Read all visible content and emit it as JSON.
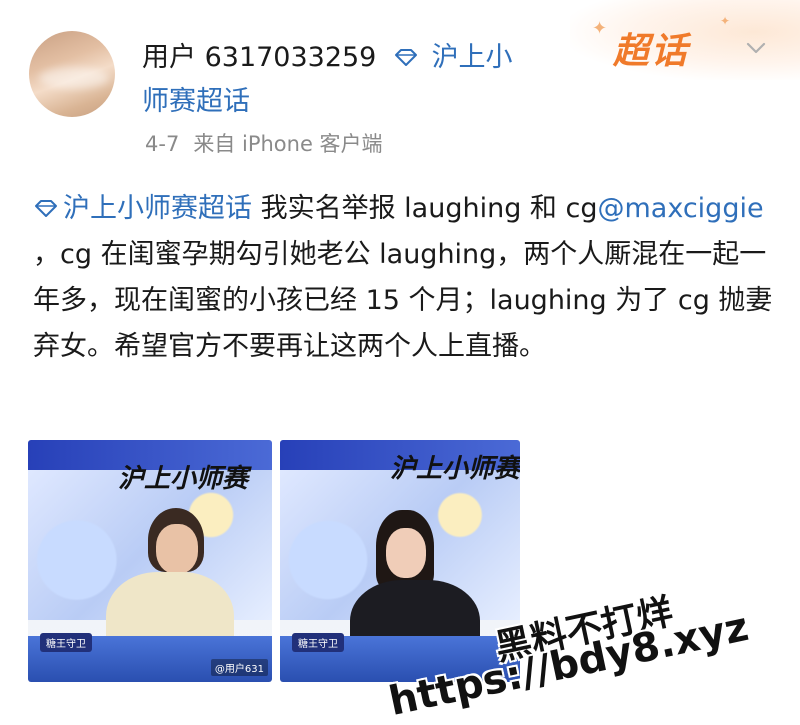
{
  "header": {
    "username": "用户 6317033259",
    "topic_line1": "沪上小",
    "topic_line2": "师赛超话",
    "badge": "超话"
  },
  "meta": {
    "date": "4-7",
    "source_prefix": "来自",
    "source_device": "iPhone 客户端"
  },
  "post": {
    "topic": "沪上小师赛超话",
    "text_part1": " 我实名举报 laughing 和 cg",
    "mention": "@maxciggie",
    "text_part2": " ，cg 在闺蜜孕期勾引她老公 laughing，两个人厮混在一起一年多，现在闺蜜的小孩已经 15 个月；laughing 为了 cg 抛妻弃女。希望官方不要再让这两个人上直播。"
  },
  "images": [
    {
      "caption": "@用户631",
      "tag": "糖王守卫",
      "logo": "沪上小师赛"
    },
    {
      "caption": "",
      "tag": "糖王守卫",
      "logo": "沪上小师赛"
    }
  ],
  "watermark": {
    "line1": "黑料不打烊",
    "line2": "https://bdy8.xyz"
  },
  "colors": {
    "link": "#2f6fba",
    "badge": "#f07a2a",
    "meta": "#8a8a8a"
  }
}
